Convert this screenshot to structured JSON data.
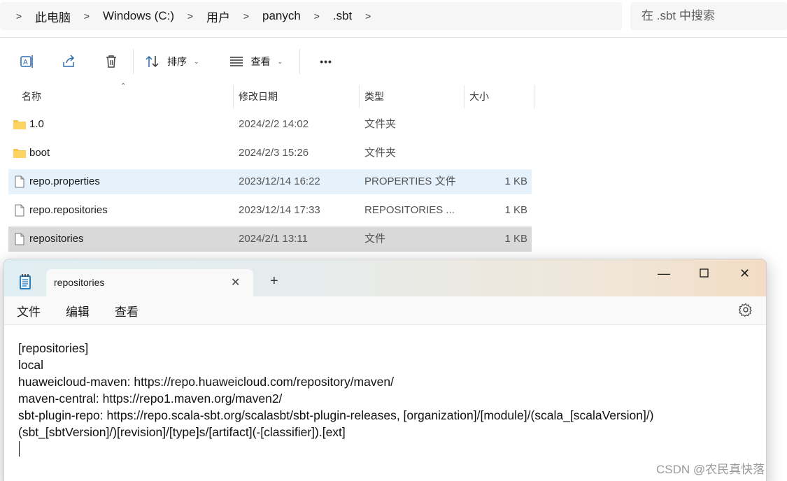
{
  "explorer": {
    "breadcrumb": [
      "此电脑",
      "Windows (C:)",
      "用户",
      "panych",
      ".sbt"
    ],
    "search_placeholder": "在 .sbt 中搜索",
    "toolbar": {
      "sort_label": "排序",
      "view_label": "查看",
      "more_label": "•••"
    },
    "columns": {
      "name": "名称",
      "date": "修改日期",
      "type": "类型",
      "size": "大小"
    },
    "files": [
      {
        "name": "1.0",
        "date": "2024/2/2 14:02",
        "type": "文件夹",
        "size": "",
        "kind": "folder",
        "state": ""
      },
      {
        "name": "boot",
        "date": "2024/2/3 15:26",
        "type": "文件夹",
        "size": "",
        "kind": "folder",
        "state": ""
      },
      {
        "name": "repo.properties",
        "date": "2023/12/14 16:22",
        "type": "PROPERTIES 文件",
        "size": "1 KB",
        "kind": "file",
        "state": "selected"
      },
      {
        "name": "repo.repositories",
        "date": "2023/12/14 17:33",
        "type": "REPOSITORIES ...",
        "size": "1 KB",
        "kind": "file",
        "state": ""
      },
      {
        "name": "repositories",
        "date": "2024/2/1 13:11",
        "type": "文件",
        "size": "1 KB",
        "kind": "file",
        "state": "hovered"
      }
    ]
  },
  "notepad": {
    "tab_title": "repositories",
    "menu": [
      "文件",
      "编辑",
      "查看"
    ],
    "lines": [
      "[repositories]",
      "local",
      "huaweicloud-maven: https://repo.huaweicloud.com/repository/maven/",
      "maven-central: https://repo1.maven.org/maven2/",
      "sbt-plugin-repo: https://repo.scala-sbt.org/scalasbt/sbt-plugin-releases, [organization]/[module]/(scala_[scalaVersion]/)",
      "(sbt_[sbtVersion]/)[revision]/[type]s/[artifact](-[classifier]).[ext]"
    ]
  },
  "watermark": "CSDN @农民真快落",
  "colors": {
    "selected_row": "#e5f1fb",
    "hovered_row": "#d9d9d9",
    "folder": "#f6c446"
  }
}
